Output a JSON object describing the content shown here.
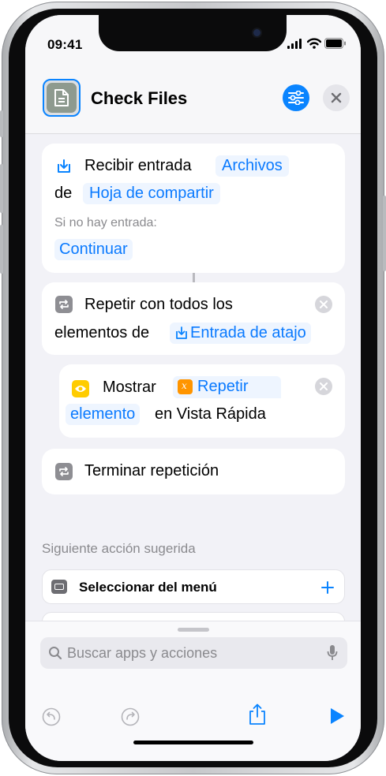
{
  "status": {
    "time": "09:41"
  },
  "header": {
    "title": "Check Files"
  },
  "actions": [
    {
      "verb": "Recibir entrada",
      "type_token": "Archivos",
      "from_label": "de",
      "source_token": "Hoja de compartir",
      "no_input_label": "Si no hay entrada:",
      "fallback_token": "Continuar"
    },
    {
      "verb": "Repetir con todos los",
      "line2": "elementos de",
      "token": "Entrada de atajo"
    },
    {
      "verb": "Mostrar",
      "token_line1": "Repetir",
      "token_line2": "elemento",
      "suffix": "en Vista Rápida"
    },
    {
      "verb": "Terminar repetición"
    }
  ],
  "suggestions": {
    "section_label": "Siguiente acción sugerida",
    "items": [
      {
        "label": "Seleccionar del menú"
      }
    ]
  },
  "search": {
    "placeholder": "Buscar apps y acciones"
  },
  "colors": {
    "accent": "#0a84ff",
    "show_icon": "#ffcc00",
    "variable_icon": "#ff9500",
    "background": "#f2f2f7"
  },
  "icons": [
    "document-icon",
    "sliders-icon",
    "close-icon",
    "receive-icon",
    "repeat-icon",
    "eye-icon",
    "variable-icon",
    "menu-icon",
    "plus-icon",
    "search-icon",
    "mic-icon",
    "undo-icon",
    "redo-icon",
    "share-icon",
    "play-icon"
  ]
}
